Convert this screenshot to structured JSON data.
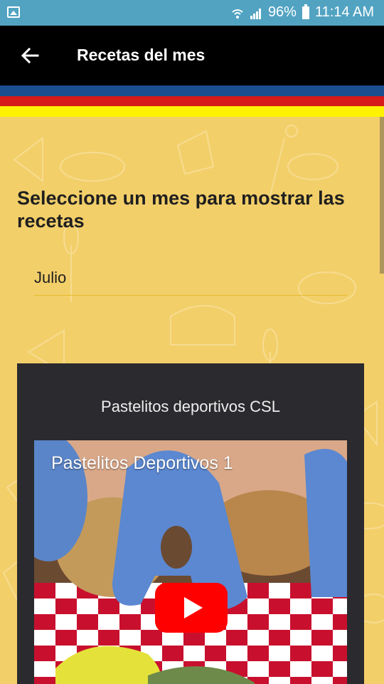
{
  "status_bar": {
    "battery": "96%",
    "time": "11:14 AM",
    "left_icon": "image-icon",
    "icons": [
      "wifi-icon",
      "signal-icon",
      "battery-icon"
    ]
  },
  "app_bar": {
    "title": "Recetas del mes",
    "back_icon": "back-arrow-icon"
  },
  "stripe_colors": {
    "blue": "#1a4e8e",
    "red": "#d61b1b",
    "yellow": "#fef200"
  },
  "main": {
    "prompt": "Seleccione un mes para mostrar las recetas",
    "month_select": {
      "selected": "Julio"
    }
  },
  "recipe_card": {
    "title": "Pastelitos deportivos CSL",
    "video": {
      "title": "Pastelitos Deportivos 1",
      "play_icon": "play-icon"
    }
  }
}
